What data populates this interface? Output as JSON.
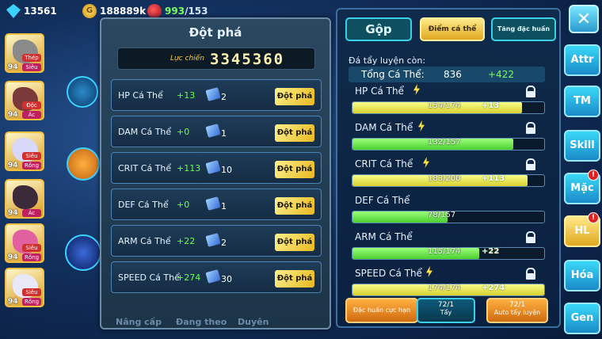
{
  "resources": {
    "gems": "13561",
    "coins": "188889k",
    "fruit_current": "993",
    "fruit_max": "/153"
  },
  "team": [
    {
      "level": "94",
      "tag1": "Thép",
      "tag2": "Siêu",
      "color": "#8a8a8a"
    },
    {
      "level": "94",
      "tag1": "Độc",
      "tag2": "Ác",
      "color": "#7a3a3a"
    },
    {
      "level": "94",
      "tag1": "Siêu",
      "tag2": "Rồng",
      "color": "#d8d8f8"
    },
    {
      "level": "94",
      "tag1": "Ác",
      "tag2": "",
      "color": "#3a2a3a"
    },
    {
      "level": "94",
      "tag1": "Siêu",
      "tag2": "Rồng",
      "color": "#e060a0"
    },
    {
      "level": "94",
      "tag1": "Siêu",
      "tag2": "Rồng",
      "color": "#e8e8f8"
    }
  ],
  "dot_pha": {
    "title": "Đột phá",
    "luc_chien_label": "Lực chiến",
    "luc_chien_value": "3345360",
    "rows": [
      {
        "name": "HP Cá Thể",
        "plus": "+13",
        "count": "2",
        "button": "Đột phá"
      },
      {
        "name": "DAM Cá Thể",
        "plus": "+0",
        "count": "1",
        "button": "Đột phá"
      },
      {
        "name": "CRIT Cá Thể",
        "plus": "+113",
        "count": "10",
        "button": "Đột phá"
      },
      {
        "name": "DEF Cá Thể",
        "plus": "+0",
        "count": "1",
        "button": "Đột phá"
      },
      {
        "name": "ARM Cá Thể",
        "plus": "+22",
        "count": "2",
        "button": "Đột phá"
      },
      {
        "name": "SPEED Cá Thể",
        "plus": "+274",
        "count": "30",
        "button": "Đột phá"
      }
    ],
    "bottom_labels": [
      "Nâng cấp",
      "Đang theo",
      "Duyên"
    ]
  },
  "panel": {
    "tabs": {
      "gop": "Gộp",
      "diem_ca_the": "Điểm cá thể",
      "tang_dac_huan": "Tăng đặc huấn"
    },
    "remaining_label": "Đá tẩy luyện còn:",
    "total_label": "Tổng Cá Thể:",
    "total_value": "836",
    "total_plus": "+422",
    "stats": [
      {
        "label": "HP Cá Thể",
        "value": "154/174",
        "plus": "+13",
        "ratio": 0.885,
        "fill": "y"
      },
      {
        "label": "DAM Cá Thể",
        "value": "132/157",
        "plus": "",
        "ratio": 0.84,
        "fill": "g"
      },
      {
        "label": "CRIT Cá Thể",
        "value": "183/200",
        "plus": "+113",
        "ratio": 0.915,
        "fill": "y"
      },
      {
        "label": "DEF Cá Thể",
        "value": "78/157",
        "plus": "",
        "ratio": 0.497,
        "fill": "g"
      },
      {
        "label": "ARM Cá Thể",
        "value": "115/174",
        "plus": "+22",
        "ratio": 0.661,
        "fill": "g"
      },
      {
        "label": "SPEED Cá Thể",
        "value": "174/174",
        "plus": "+274",
        "ratio": 1.0,
        "fill": "y"
      }
    ],
    "actions": {
      "dac_huan": "Đặc huấn cực hạn",
      "tay_count": "72/1",
      "tay_label": "Tẩy",
      "auto_count": "72/1",
      "auto_label": "Auto tẩy luyện"
    }
  },
  "nav": {
    "close": "✕",
    "items": [
      {
        "label": "Attr",
        "badge": ""
      },
      {
        "label": "TM",
        "badge": ""
      },
      {
        "label": "Skill",
        "badge": ""
      },
      {
        "label": "Mặc",
        "badge": "!"
      },
      {
        "label": "HL",
        "badge": "!"
      },
      {
        "label": "Hóa",
        "badge": ""
      },
      {
        "label": "Gen",
        "badge": ""
      }
    ]
  }
}
